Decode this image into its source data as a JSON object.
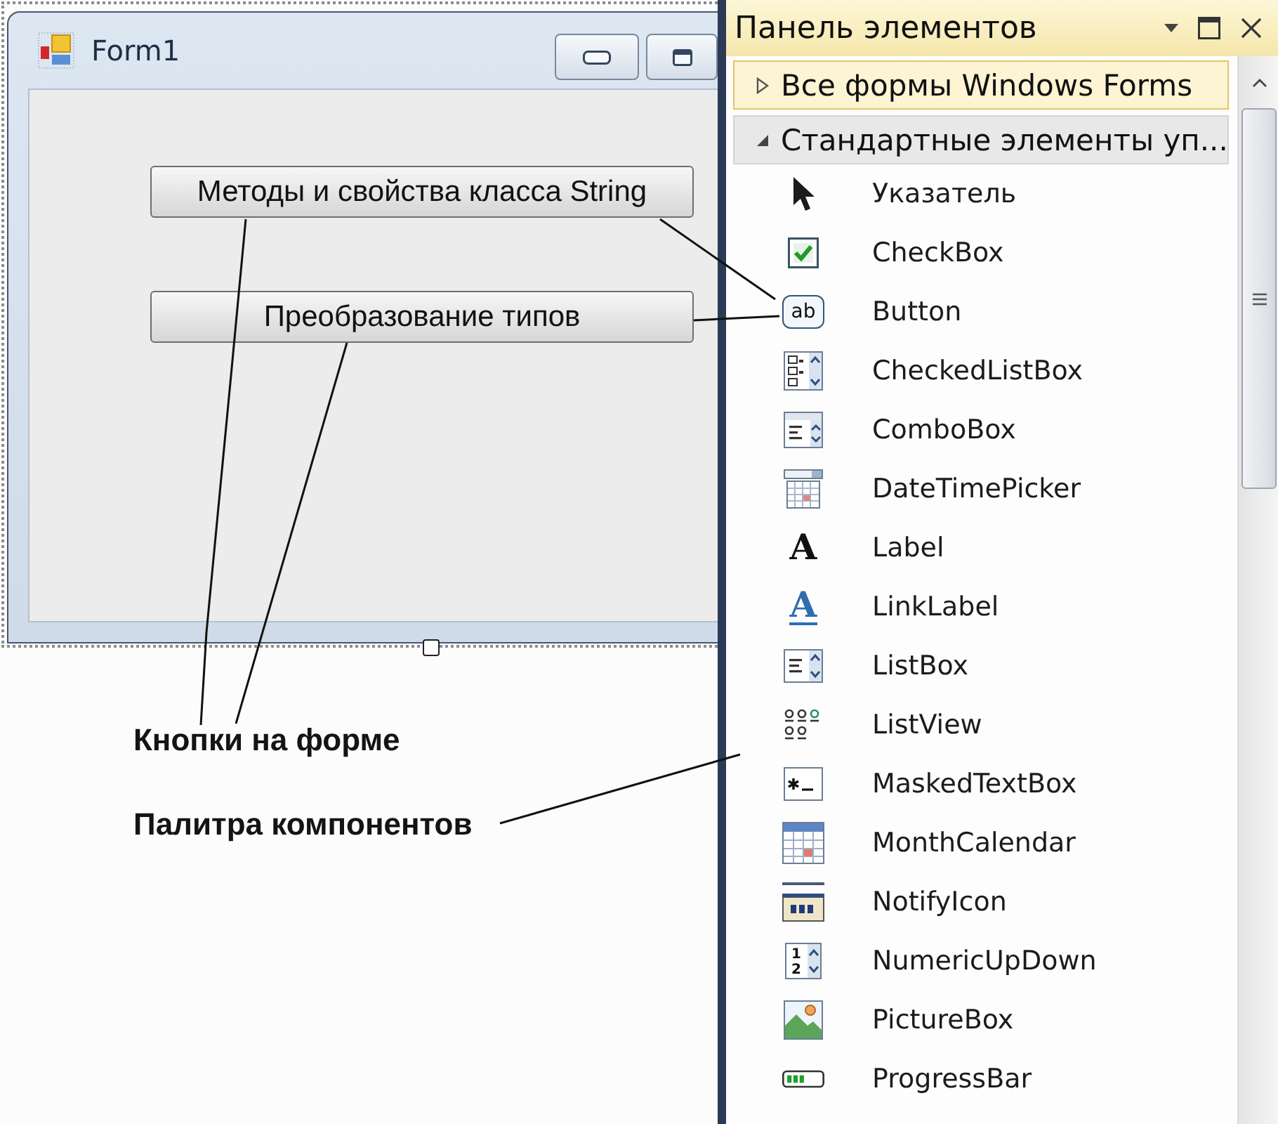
{
  "form": {
    "title": "Form1",
    "buttons": [
      {
        "label": "Методы и свойства класса String"
      },
      {
        "label": "Преобразование типов"
      }
    ]
  },
  "annotations": [
    {
      "text": "Кнопки на форме"
    },
    {
      "text": "Палитра компонентов"
    }
  ],
  "toolbox": {
    "title": "Панель элементов",
    "groups": [
      {
        "label": "Все формы Windows Forms",
        "selected": true,
        "expanded": false
      },
      {
        "label": "Стандартные элементы уп...",
        "selected": false,
        "expanded": true,
        "items": [
          {
            "label": "Указатель",
            "kind": "pointer"
          },
          {
            "label": "CheckBox",
            "kind": "checkbox"
          },
          {
            "label": "Button",
            "kind": "button",
            "glyph": "ab"
          },
          {
            "label": "CheckedListBox",
            "kind": "checkedlist"
          },
          {
            "label": "ComboBox",
            "kind": "combo"
          },
          {
            "label": "DateTimePicker",
            "kind": "datepicker"
          },
          {
            "label": "Label",
            "kind": "label",
            "glyph": "A"
          },
          {
            "label": "LinkLabel",
            "kind": "linklabel",
            "glyph": "A"
          },
          {
            "label": "ListBox",
            "kind": "listbox"
          },
          {
            "label": "ListView",
            "kind": "listview"
          },
          {
            "label": "MaskedTextBox",
            "kind": "masked"
          },
          {
            "label": "MonthCalendar",
            "kind": "calendar"
          },
          {
            "label": "NotifyIcon",
            "kind": "notify"
          },
          {
            "label": "NumericUpDown",
            "kind": "numeric",
            "glyph": "12"
          },
          {
            "label": "PictureBox",
            "kind": "picture"
          },
          {
            "label": "ProgressBar",
            "kind": "progress"
          }
        ]
      }
    ]
  }
}
